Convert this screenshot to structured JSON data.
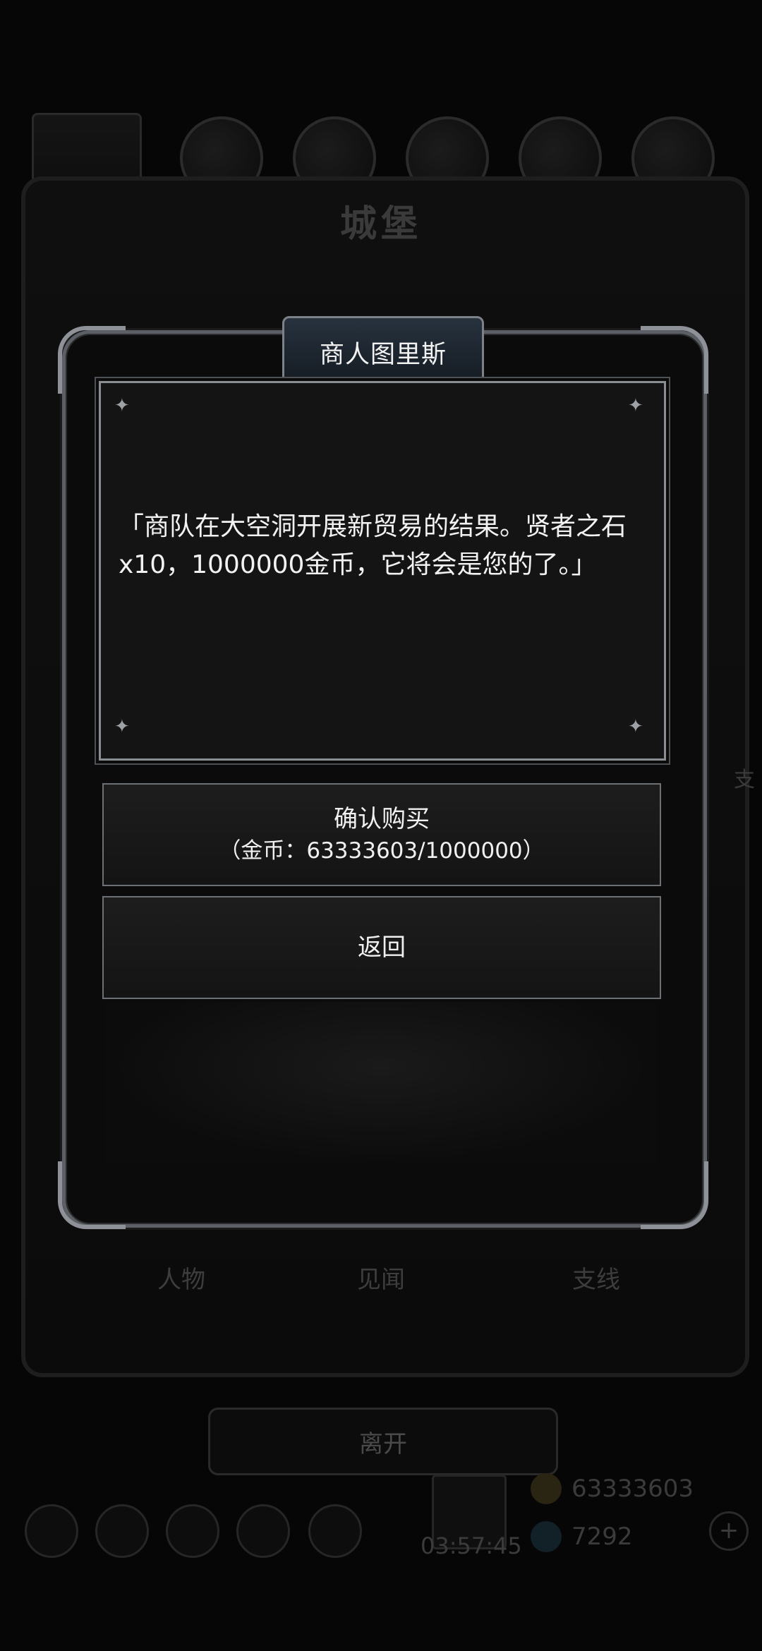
{
  "background": {
    "title": "城堡",
    "tabs": [
      "人物",
      "见闻",
      "支线"
    ],
    "leave_label": "离开",
    "timer": "03:57:45",
    "gold": "63333603",
    "gems": "7292",
    "side_text": "支"
  },
  "dialog": {
    "title": "商人图里斯",
    "message": "「商队在大空洞开展新贸易的结果。贤者之石x10，1000000金币，它将会是您的了。」",
    "confirm_label": "确认购买",
    "confirm_cost": "（金币：63333603/1000000）",
    "back_label": "返回"
  },
  "colors": {
    "frame": "#5c6066",
    "title_bar": "#27323e",
    "text_box": "#141414"
  }
}
